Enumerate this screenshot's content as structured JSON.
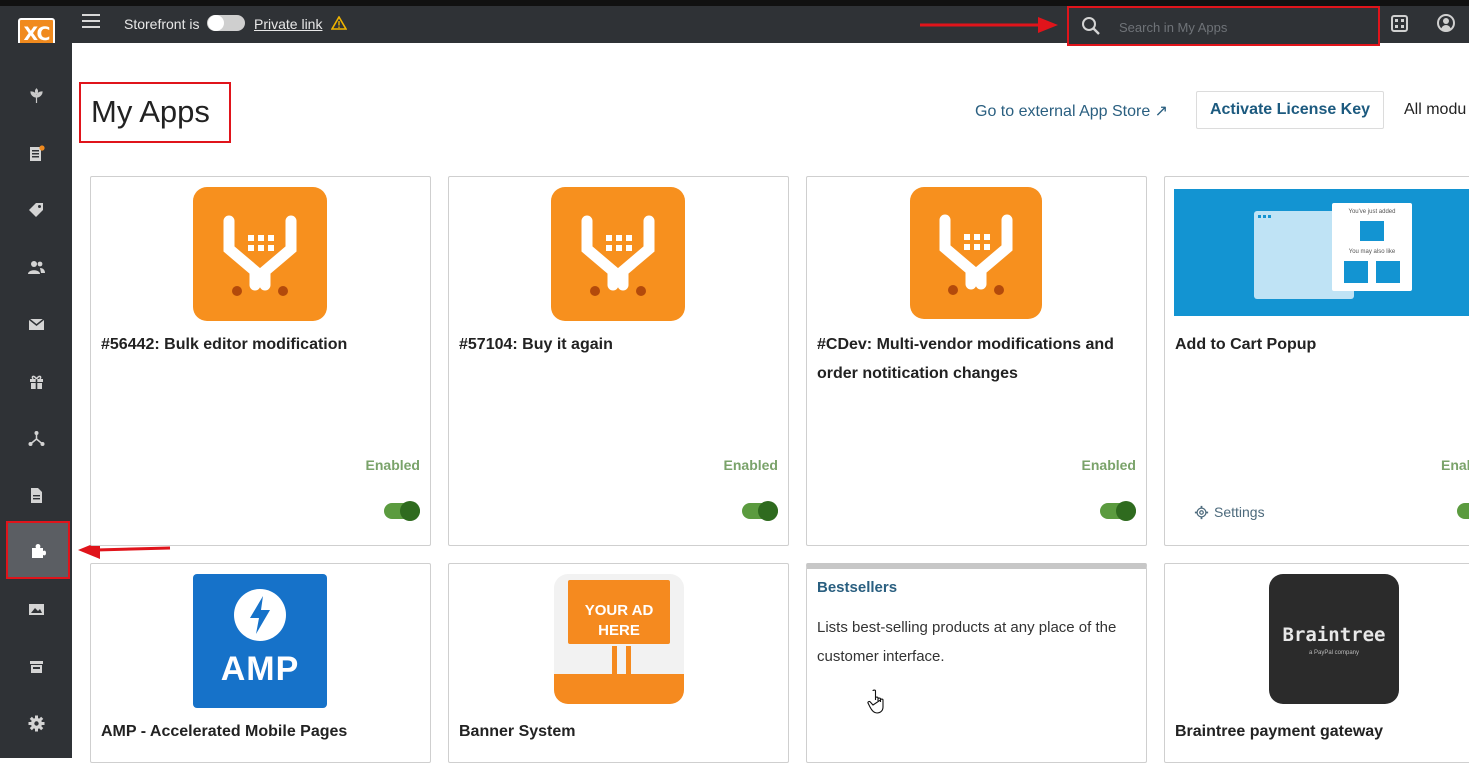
{
  "topbar": {
    "storefront_label": "Storefront is",
    "private_link": "Private link",
    "search_placeholder": "Search in My Apps"
  },
  "page": {
    "title": "My Apps",
    "external_store_link": "Go to external App Store ↗",
    "activate_button": "Activate License Key",
    "all_modules": "All modu"
  },
  "cards": [
    {
      "title": "#56442: Bulk editor modification",
      "status": "Enabled",
      "enabled": true
    },
    {
      "title": "#57104: Buy it again",
      "status": "Enabled",
      "enabled": true
    },
    {
      "title": "#CDev: Multi-vendor modifications and order notitication changes",
      "status": "Enabled",
      "enabled": true
    },
    {
      "title": "Add to Cart Popup",
      "status": "Enal",
      "settings": "Settings",
      "enabled": true,
      "banner": {
        "added": "You've just added",
        "also_like": "You may also like"
      }
    },
    {
      "title": "AMP - Accelerated Mobile Pages",
      "icon_text": "AMP"
    },
    {
      "title": "Banner System",
      "icon_text_1": "YOUR AD",
      "icon_text_2": "HERE"
    },
    {
      "title": "Bestsellers",
      "description": "Lists best-selling products at any place of the customer interface."
    },
    {
      "title": "Braintree payment gateway",
      "icon_text": "Braintree",
      "icon_subtext": "a PayPal company"
    }
  ],
  "colors": {
    "sidebar": "#2f3236",
    "accent_orange": "#f7901e",
    "highlight_red": "#e0141b",
    "toggle_green": "#5b9b3f",
    "link_blue": "#2a5f80"
  }
}
